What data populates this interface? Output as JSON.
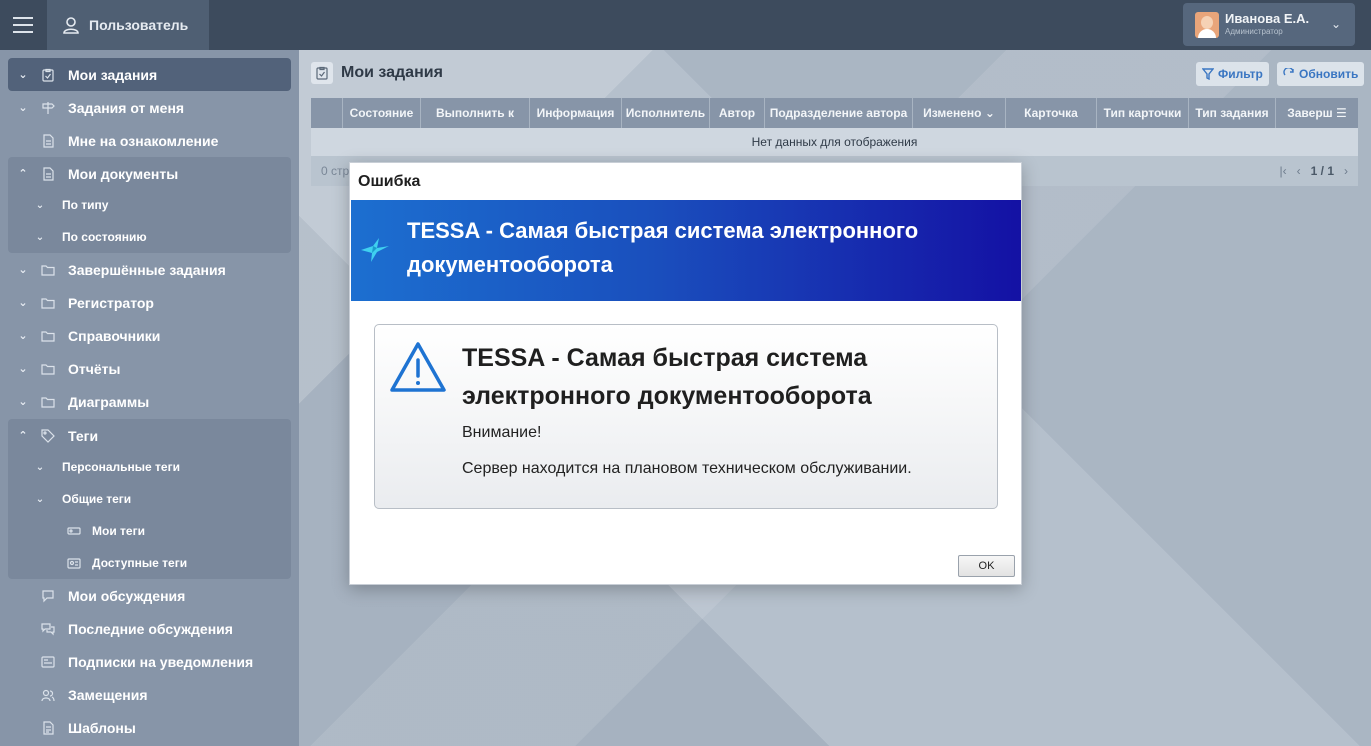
{
  "topbar": {
    "user_tab_label": "Пользователь",
    "profile_name": "Иванова Е.А.",
    "profile_role": "Администратор"
  },
  "sidebar": {
    "items": [
      {
        "label": "Мои задания"
      },
      {
        "label": "Задания от меня"
      },
      {
        "label": "Мне на ознакомление"
      },
      {
        "label": "Мои документы"
      },
      {
        "label": "По типу"
      },
      {
        "label": "По состоянию"
      },
      {
        "label": "Завершённые задания"
      },
      {
        "label": "Регистратор"
      },
      {
        "label": "Справочники"
      },
      {
        "label": "Отчёты"
      },
      {
        "label": "Диаграммы"
      },
      {
        "label": "Теги"
      },
      {
        "label": "Персональные теги"
      },
      {
        "label": "Общие теги"
      },
      {
        "label": "Мои теги"
      },
      {
        "label": "Доступные теги"
      },
      {
        "label": "Мои обсуждения"
      },
      {
        "label": "Последние обсуждения"
      },
      {
        "label": "Подписки на уведомления"
      },
      {
        "label": "Замещения"
      },
      {
        "label": "Шаблоны"
      }
    ]
  },
  "main": {
    "title": "Мои задания",
    "filter_label": "Фильтр",
    "refresh_label": "Обновить",
    "columns": [
      "Состояние",
      "Выполнить к",
      "Информация",
      "Исполнитель",
      "Автор",
      "Подразделение автора",
      "Изменено",
      "Карточка",
      "Тип карточки",
      "Тип задания",
      "Заверш"
    ],
    "empty_text": "Нет данных для отображения",
    "footer_left": "0 стр",
    "page": "1 / 1"
  },
  "dialog": {
    "title": "Ошибка",
    "banner": "TESSA - Самая быстрая система электронного документооборота",
    "message_title": "TESSA - Самая быстрая система электронного документооборота",
    "line1": "Внимание!",
    "line2": "Сервер находится на плановом техническом обслуживании.",
    "ok_label": "OK"
  }
}
